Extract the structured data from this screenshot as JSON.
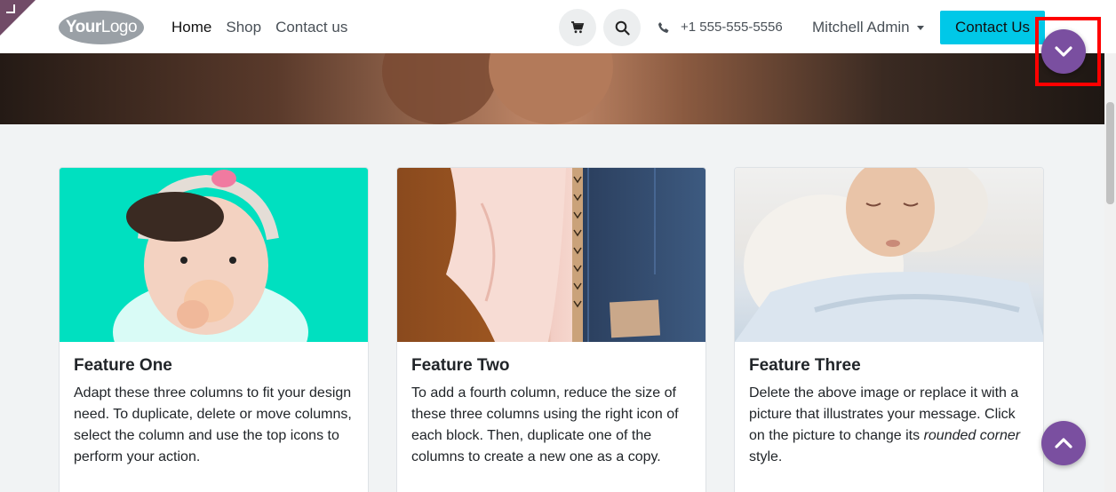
{
  "header": {
    "logo": {
      "bold": "Your",
      "light": "Logo"
    },
    "nav": [
      {
        "label": "Home"
      },
      {
        "label": "Shop"
      },
      {
        "label": "Contact us"
      }
    ],
    "phone": "+1 555-555-5556",
    "user": "Mitchell Admin",
    "contact_button": "Contact Us"
  },
  "cards": [
    {
      "title": "Feature One",
      "text": "Adapt these three columns to fit your design need. To duplicate, delete or move columns, select the column and use the top icons to perform your action."
    },
    {
      "title": "Feature Two",
      "text": "To add a fourth column, reduce the size of these three columns using the right icon of each block. Then, duplicate one of the columns to create a new one as a copy."
    },
    {
      "title": "Feature Three",
      "text_before": "Delete the above image or replace it with a picture that illustrates your message. Click on the picture to change its ",
      "text_em": "rounded corner",
      "text_after": " style."
    }
  ],
  "colors": {
    "accent": "#00c8e8",
    "purple": "#7a4fa0",
    "highlight": "#ff0000"
  },
  "icons": {
    "cart": "cart-icon",
    "search": "search-icon",
    "phone": "phone-icon",
    "scroll_down": "chevron-down-icon",
    "scroll_up": "chevron-up-icon"
  }
}
